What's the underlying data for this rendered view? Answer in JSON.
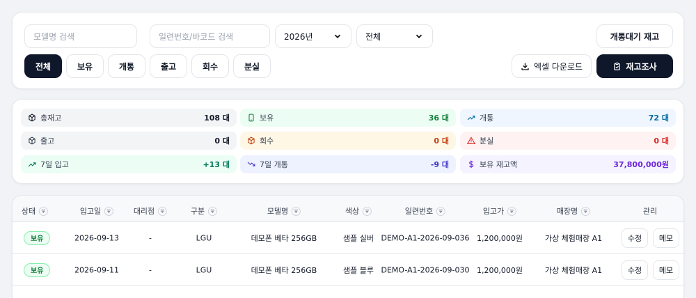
{
  "filters": {
    "model_search_placeholder": "모델명 검색",
    "serial_search_placeholder": "일련번호/바코드 검색",
    "year_select": "2026년",
    "scope_select": "전체",
    "pending_stock_button": "개통대기 재고",
    "tabs": [
      "전체",
      "보유",
      "개통",
      "출고",
      "회수",
      "분실"
    ],
    "active_tab": "전체",
    "excel_download_button": "엑셀 다운로드",
    "inventory_check_button": "재고조사"
  },
  "stats": [
    {
      "label": "총재고",
      "value": "108 대",
      "icon": "box-icon",
      "bg": "#f3f4f6",
      "color": "#111827"
    },
    {
      "label": "보유",
      "value": "36 대",
      "icon": "phone-icon",
      "bg": "#ecfdf3",
      "color": "#15803d"
    },
    {
      "label": "개통",
      "value": "72 대",
      "icon": "trend-up-icon",
      "bg": "#eff6ff",
      "color": "#0369a1"
    },
    {
      "label": "출고",
      "value": "0 대",
      "icon": "box-out-icon",
      "bg": "#f3f4f6",
      "color": "#111827"
    },
    {
      "label": "회수",
      "value": "0 대",
      "icon": "box-return-icon",
      "bg": "#fff7e6",
      "color": "#c2410c"
    },
    {
      "label": "분실",
      "value": "0 대",
      "icon": "warning-icon",
      "bg": "#fef2f2",
      "color": "#dc2626"
    },
    {
      "label": "7일 입고",
      "value": "+13 대",
      "icon": "trend-up-icon",
      "bg": "#ecfdf5",
      "color": "#047857"
    },
    {
      "label": "7일 개통",
      "value": "-9 대",
      "icon": "trend-down-icon",
      "bg": "#eef2ff",
      "color": "#4338ca"
    },
    {
      "label": "보유 재고액",
      "value": "37,800,000원",
      "icon": "dollar-icon",
      "bg": "#f5f3ff",
      "color": "#6d28d9"
    }
  ],
  "table": {
    "columns": [
      "상태",
      "입고일",
      "대리점",
      "구분",
      "모델명",
      "색상",
      "일련번호",
      "입고가",
      "매장명",
      "관리"
    ],
    "rows": [
      {
        "status": "보유",
        "date": "2026-09-13",
        "agency": "-",
        "carrier": "LGU",
        "model": "데모폰 베타 256GB",
        "color": "샘플 실버",
        "serial": "DEMO-A1-2026-09-036",
        "price": "1,200,000원",
        "store": "가상 체험매장 A1",
        "edit": "수정",
        "memo": "메모"
      },
      {
        "status": "보유",
        "date": "2026-09-11",
        "agency": "-",
        "carrier": "LGU",
        "model": "데모폰 베타 256GB",
        "color": "샘플 블루",
        "serial": "DEMO-A1-2026-09-030",
        "price": "1,200,000원",
        "store": "가상 체험매장 A1",
        "edit": "수정",
        "memo": "메모"
      }
    ]
  }
}
